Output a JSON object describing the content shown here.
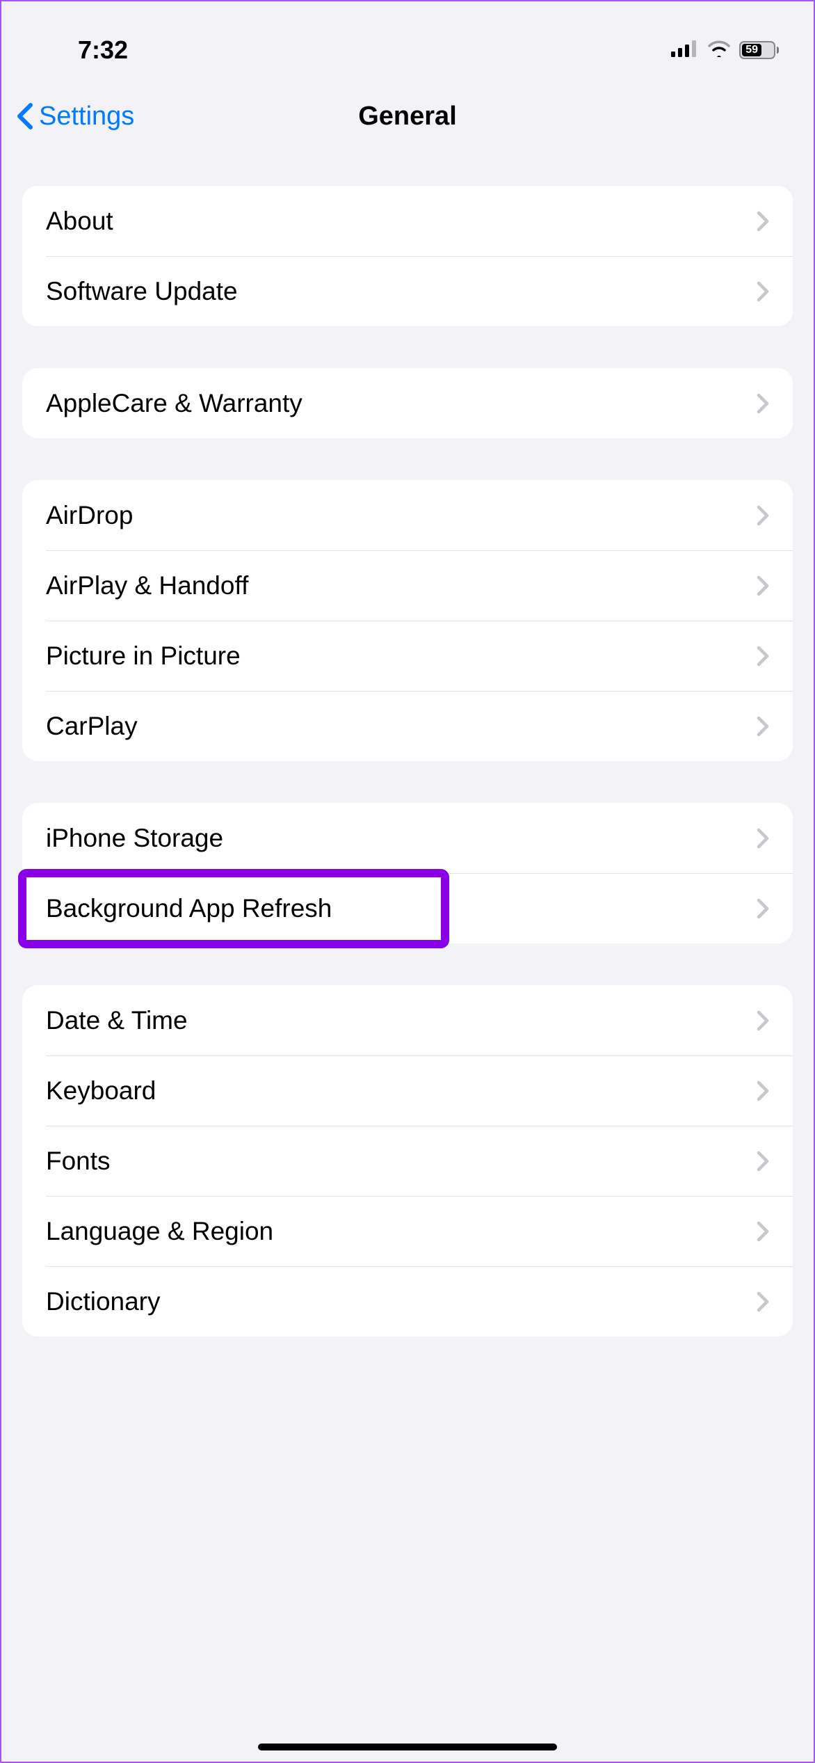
{
  "status": {
    "time": "7:32",
    "battery_pct": "59"
  },
  "nav": {
    "back_label": "Settings",
    "title": "General"
  },
  "groups": [
    {
      "rows": [
        {
          "id": "about",
          "label": "About"
        },
        {
          "id": "software-update",
          "label": "Software Update"
        }
      ]
    },
    {
      "rows": [
        {
          "id": "applecare-warranty",
          "label": "AppleCare & Warranty"
        }
      ]
    },
    {
      "rows": [
        {
          "id": "airdrop",
          "label": "AirDrop"
        },
        {
          "id": "airplay-handoff",
          "label": "AirPlay & Handoff"
        },
        {
          "id": "picture-in-picture",
          "label": "Picture in Picture"
        },
        {
          "id": "carplay",
          "label": "CarPlay"
        }
      ]
    },
    {
      "rows": [
        {
          "id": "iphone-storage",
          "label": "iPhone Storage"
        },
        {
          "id": "background-app-refresh",
          "label": "Background App Refresh",
          "highlighted": true
        }
      ]
    },
    {
      "rows": [
        {
          "id": "date-time",
          "label": "Date & Time"
        },
        {
          "id": "keyboard",
          "label": "Keyboard"
        },
        {
          "id": "fonts",
          "label": "Fonts"
        },
        {
          "id": "language-region",
          "label": "Language & Region"
        },
        {
          "id": "dictionary",
          "label": "Dictionary"
        }
      ]
    }
  ]
}
